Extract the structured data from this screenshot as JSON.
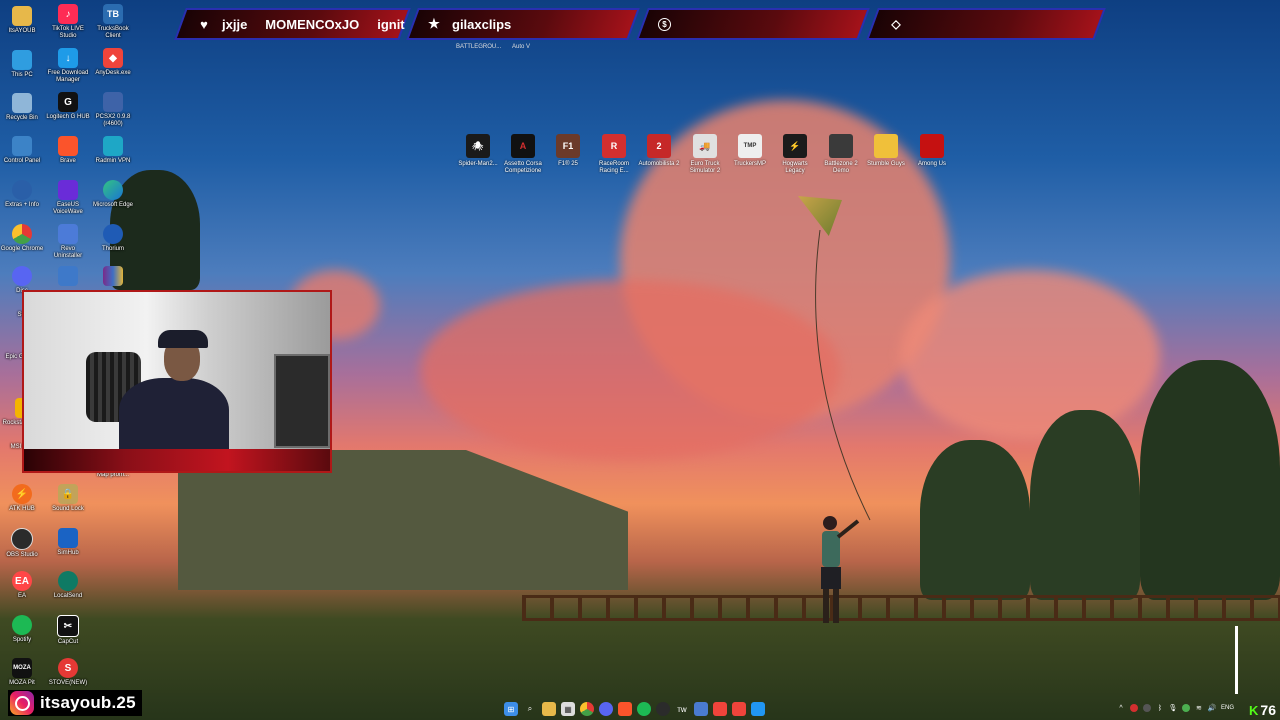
{
  "alerts": {
    "segment1": {
      "icon": "heart-icon",
      "names": [
        "jxjje",
        "MOMENCOxJO",
        "ignit"
      ]
    },
    "segment2": {
      "icon": "star-icon",
      "name": "gilaxclips",
      "sub_labels": [
        "BATTLEGROU...",
        "Auto V"
      ]
    },
    "segment3": {
      "icon": "dollar-icon"
    },
    "segment4": {
      "icon": "diamond-icon"
    }
  },
  "desktop_icons": {
    "col1": [
      "ItsAYOUB",
      "This PC",
      "Recycle Bin",
      "Control Panel",
      "Extras + Info",
      "Google Chrome",
      "Disc",
      "Ste",
      "Epic G Laun",
      "Rockstar Laun",
      "MSI Afte",
      "ATK HUB",
      "OBS Studio",
      "EA",
      "Spotify",
      "MOZA Pit"
    ],
    "col2": [
      "TikTok LIVE Studio",
      "Free Download Manager",
      "Logitech G HUB",
      "Brave",
      "EaseUS VoiceWave",
      "Revo Uninstaller",
      "Map prom...",
      "Sound Lock",
      "SimHub",
      "LocalSend",
      "CapCut",
      "STOVE(NEW)"
    ],
    "col3": [
      "TrucksBook Client",
      "AnyDesk.exe",
      "PCSX2 0.9.8 (r4600)",
      "Radmin VPN",
      "Microsoft Edge",
      "Thorium"
    ]
  },
  "game_icons": [
    "Spider-Man2...",
    "Assetto Corsa Competizione",
    "F1® 25",
    "RaceRoom Racing E...",
    "Automobilista 2",
    "Euro Truck Simulator 2",
    "TruckersMP",
    "Hogwarts Legacy",
    "Battlezone 2 Demo",
    "Stumble Guys",
    "Among Us"
  ],
  "webcam": {
    "label": "webcam-overlay"
  },
  "instagram": {
    "handle": "itsayoub.25"
  },
  "taskbar": {
    "tray_lang": "ENG",
    "score": "76"
  },
  "colors": {
    "alert_red": "#a4121a",
    "alert_border": "#2a2fb0",
    "taskbar_bg": "transparent"
  }
}
